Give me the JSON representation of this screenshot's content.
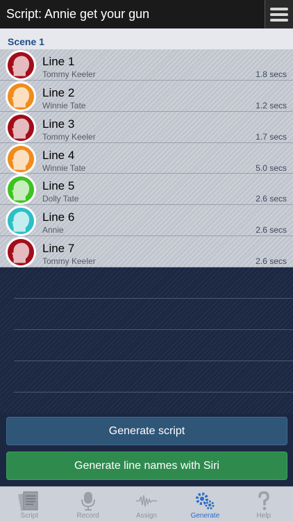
{
  "header": {
    "title": "Script:  Annie get your gun"
  },
  "scene": {
    "label": "Scene 1"
  },
  "lines": [
    {
      "title": "Line 1",
      "actor": "Tommy Keeler",
      "time": "1.8 secs",
      "color": "#a30d1a"
    },
    {
      "title": "Line 2",
      "actor": "Winnie Tate",
      "time": "1.2 secs",
      "color": "#f08c1c"
    },
    {
      "title": "Line 3",
      "actor": "Tommy Keeler",
      "time": "1.7 secs",
      "color": "#a30d1a"
    },
    {
      "title": "Line 4",
      "actor": "Winnie Tate",
      "time": "5.0 secs",
      "color": "#f08c1c"
    },
    {
      "title": "Line 5",
      "actor": "Dolly Tate",
      "time": "2.6 secs",
      "color": "#3cc31f"
    },
    {
      "title": "Line 6",
      "actor": "Annie",
      "time": "2.6 secs",
      "color": "#2bbfc7"
    },
    {
      "title": "Line 7",
      "actor": "Tommy Keeler",
      "time": "2.6 secs",
      "color": "#a30d1a"
    }
  ],
  "buttons": {
    "generate": "Generate script",
    "siri": "Generate line names with Siri"
  },
  "tabs": [
    {
      "label": "Script",
      "icon": "script-pages-icon"
    },
    {
      "label": "Record",
      "icon": "microphone-icon"
    },
    {
      "label": "Assign",
      "icon": "waveform-icon"
    },
    {
      "label": "Generate",
      "icon": "gears-icon",
      "active": true
    },
    {
      "label": "Help",
      "icon": "question-mark-icon"
    }
  ],
  "colors": {
    "active_tab": "#2b6cc8",
    "generate_button": "#2f5577",
    "siri_button": "#2f8a4e"
  }
}
